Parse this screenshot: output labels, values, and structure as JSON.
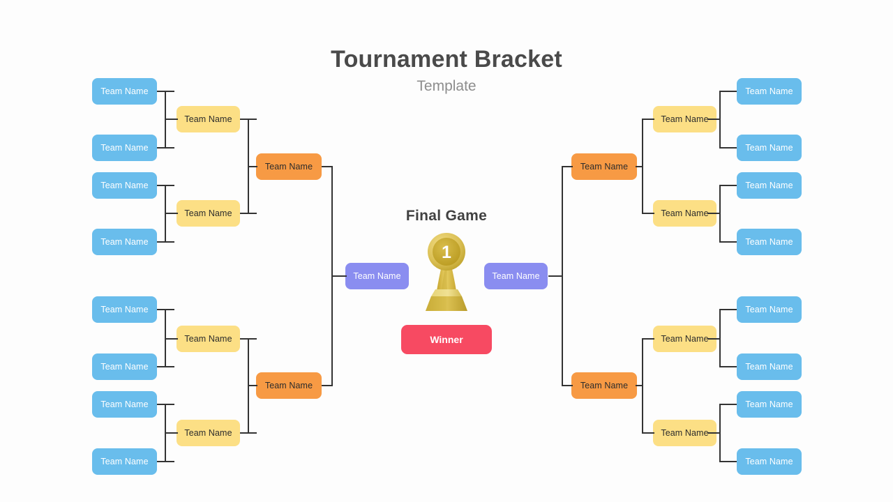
{
  "header": {
    "title": "Tournament Bracket",
    "subtitle": "Template"
  },
  "center": {
    "final_label": "Final Game",
    "winner_label": "Winner",
    "trophy_rank": "1"
  },
  "colors": {
    "round1_blue": "#69bdec",
    "round2_yellow": "#fcdf85",
    "round3_orange": "#f79a44",
    "final_purple": "#8a8df0",
    "winner_red": "#f74a62",
    "connector": "#333333",
    "title_text": "#4a4a4a",
    "subtitle_text": "#8d8d8d",
    "trophy_gold": "#d8b game"
  },
  "team_label": "Team Name",
  "bracket": {
    "left": {
      "round1": [
        {
          "label": "Team Name"
        },
        {
          "label": "Team Name"
        },
        {
          "label": "Team Name"
        },
        {
          "label": "Team Name"
        },
        {
          "label": "Team Name"
        },
        {
          "label": "Team Name"
        },
        {
          "label": "Team Name"
        },
        {
          "label": "Team Name"
        }
      ],
      "round2": [
        {
          "label": "Team Name"
        },
        {
          "label": "Team Name"
        },
        {
          "label": "Team Name"
        },
        {
          "label": "Team Name"
        }
      ],
      "round3": [
        {
          "label": "Team Name"
        },
        {
          "label": "Team Name"
        }
      ],
      "final": [
        {
          "label": "Team Name"
        }
      ]
    },
    "right": {
      "round1": [
        {
          "label": "Team Name"
        },
        {
          "label": "Team Name"
        },
        {
          "label": "Team Name"
        },
        {
          "label": "Team Name"
        },
        {
          "label": "Team Name"
        },
        {
          "label": "Team Name"
        },
        {
          "label": "Team Name"
        },
        {
          "label": "Team Name"
        }
      ],
      "round2": [
        {
          "label": "Team Name"
        },
        {
          "label": "Team Name"
        },
        {
          "label": "Team Name"
        },
        {
          "label": "Team Name"
        }
      ],
      "round3": [
        {
          "label": "Team Name"
        },
        {
          "label": "Team Name"
        }
      ],
      "final": [
        {
          "label": "Team Name"
        }
      ]
    }
  }
}
